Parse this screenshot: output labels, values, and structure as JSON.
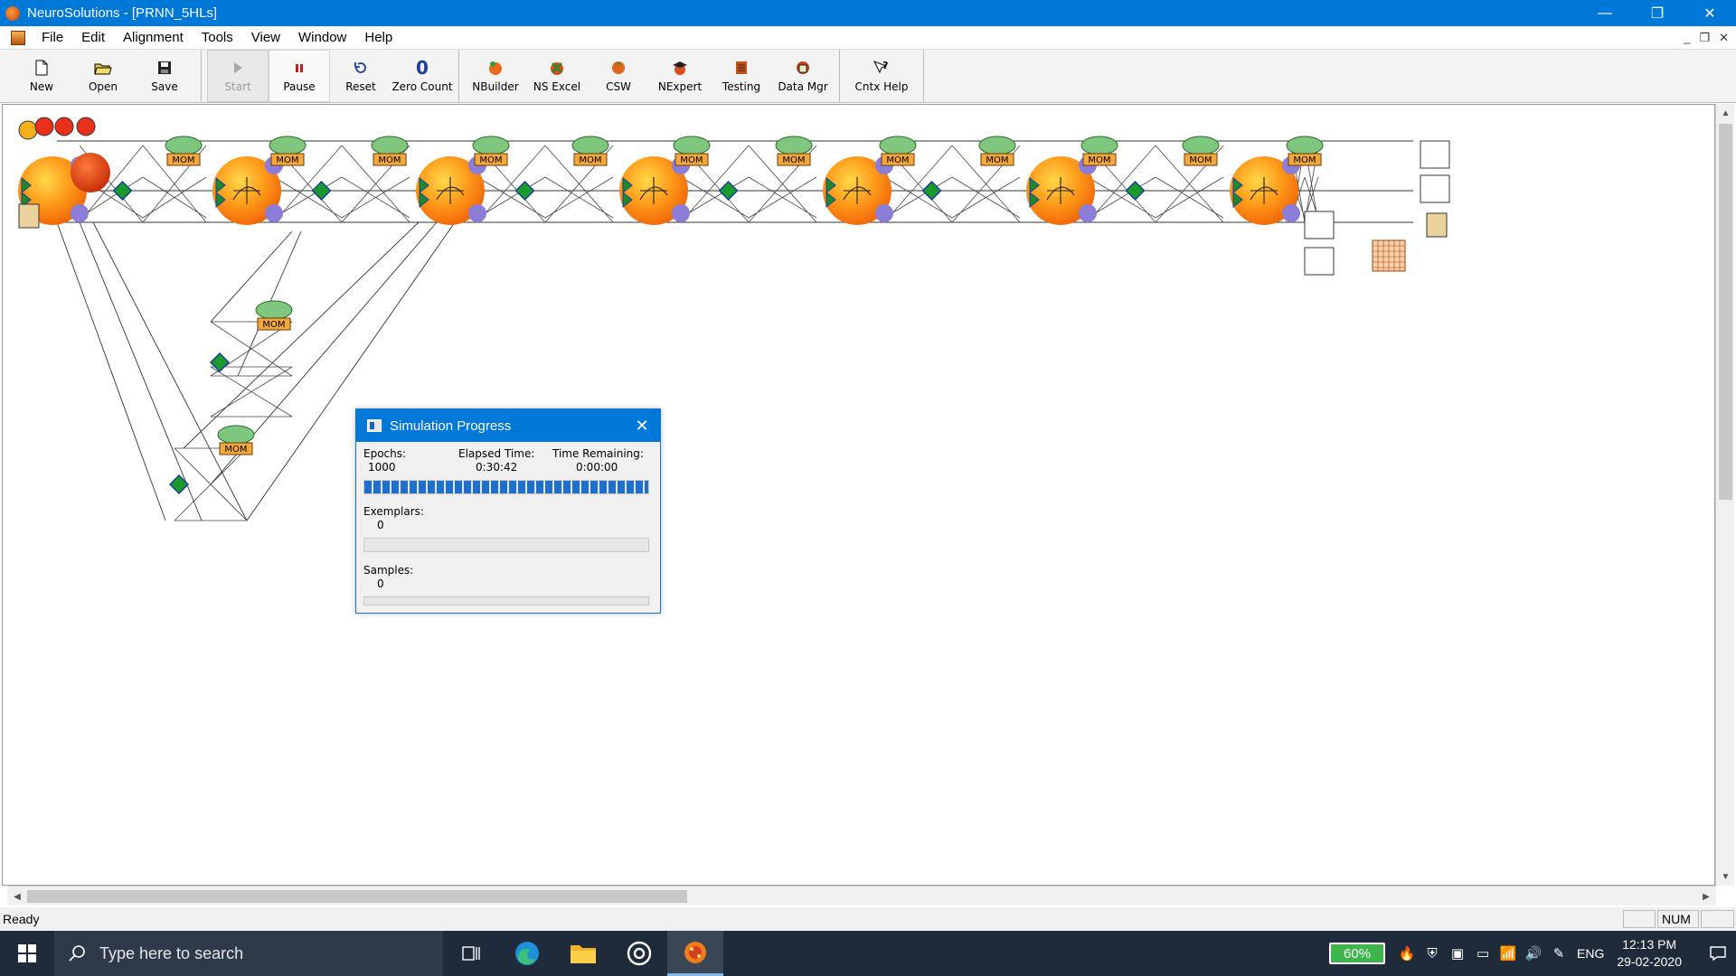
{
  "window": {
    "title": "NeuroSolutions - [PRNN_5HLs]",
    "controls": {
      "minimize": "—",
      "restore": "❐",
      "close": "✕"
    }
  },
  "menu": {
    "items": [
      "File",
      "Edit",
      "Alignment",
      "Tools",
      "View",
      "Window",
      "Help"
    ],
    "mdi_controls": {
      "minimize": "_",
      "restore": "❐",
      "close": "✕"
    }
  },
  "toolbar": {
    "groups": [
      [
        {
          "label": "New",
          "icon": "new-document-icon"
        },
        {
          "label": "Open",
          "icon": "open-folder-icon"
        },
        {
          "label": "Save",
          "icon": "save-disk-icon"
        }
      ],
      [
        {
          "label": "Start",
          "icon": "play-icon",
          "state": "disabled"
        },
        {
          "label": "Pause",
          "icon": "pause-icon",
          "state": "pressed"
        },
        {
          "label": "Reset",
          "icon": "reset-icon"
        },
        {
          "label": "Zero Count",
          "icon": "zero-icon"
        }
      ],
      [
        {
          "label": "NBuilder",
          "icon": "nbuilder-icon"
        },
        {
          "label": "NS Excel",
          "icon": "ns-excel-icon"
        },
        {
          "label": "CSW",
          "icon": "csw-icon"
        },
        {
          "label": "NExpert",
          "icon": "nexpert-icon"
        },
        {
          "label": "Testing",
          "icon": "testing-icon"
        },
        {
          "label": "Data Mgr",
          "icon": "data-manager-icon"
        }
      ],
      [
        {
          "label": "Cntx Help",
          "icon": "context-help-icon"
        }
      ]
    ]
  },
  "canvas": {
    "momentum_label": "MOM",
    "momentum_count": 15
  },
  "dialog": {
    "title": "Simulation Progress",
    "epochs_label": "Epochs:",
    "epochs_value": "1000",
    "elapsed_label": "Elapsed Time:",
    "elapsed_value": "0:30:42",
    "remaining_label": "Time Remaining:",
    "remaining_value": "0:00:00",
    "epochs_progress": 1.0,
    "exemplars_label": "Exemplars:",
    "exemplars_value": "0",
    "exemplars_progress": 0.0,
    "samples_label": "Samples:",
    "samples_value": "0",
    "samples_progress": 0.0
  },
  "status": {
    "text": "Ready",
    "num": "NUM"
  },
  "taskbar": {
    "search_placeholder": "Type here to search",
    "battery": "60%",
    "language": "ENG",
    "time": "12:13 PM",
    "date": "29-02-2020"
  }
}
